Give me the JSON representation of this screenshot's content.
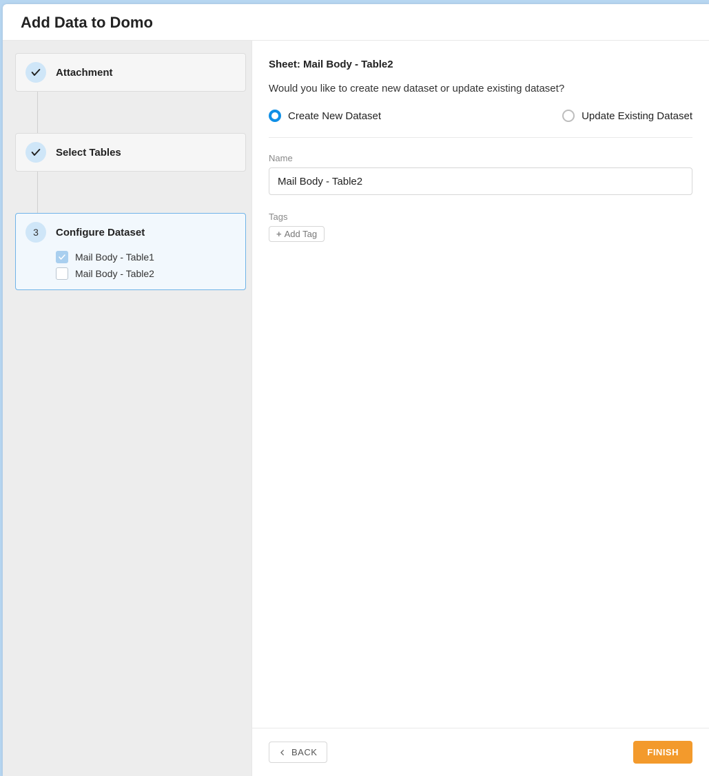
{
  "header": {
    "title": "Add Data to Domo"
  },
  "sidebar": {
    "steps": [
      {
        "label": "Attachment",
        "status": "done"
      },
      {
        "label": "Select Tables",
        "status": "done"
      },
      {
        "label": "Configure Dataset",
        "status": "active",
        "number": "3",
        "items": [
          {
            "label": "Mail Body - Table1",
            "checked": true
          },
          {
            "label": "Mail Body - Table2",
            "checked": false
          }
        ]
      }
    ]
  },
  "main": {
    "sheet_prefix": "Sheet: ",
    "sheet_name": "Mail Body - Table2",
    "prompt": "Would you like to create new dataset or update existing dataset?",
    "radios": {
      "create": "Create New Dataset",
      "update": "Update Existing Dataset",
      "selected": "create"
    },
    "name_label": "Name",
    "name_value": "Mail Body - Table2",
    "tags_label": "Tags",
    "add_tag_label": "Add Tag"
  },
  "footer": {
    "back": "BACK",
    "finish": "FINISH"
  }
}
